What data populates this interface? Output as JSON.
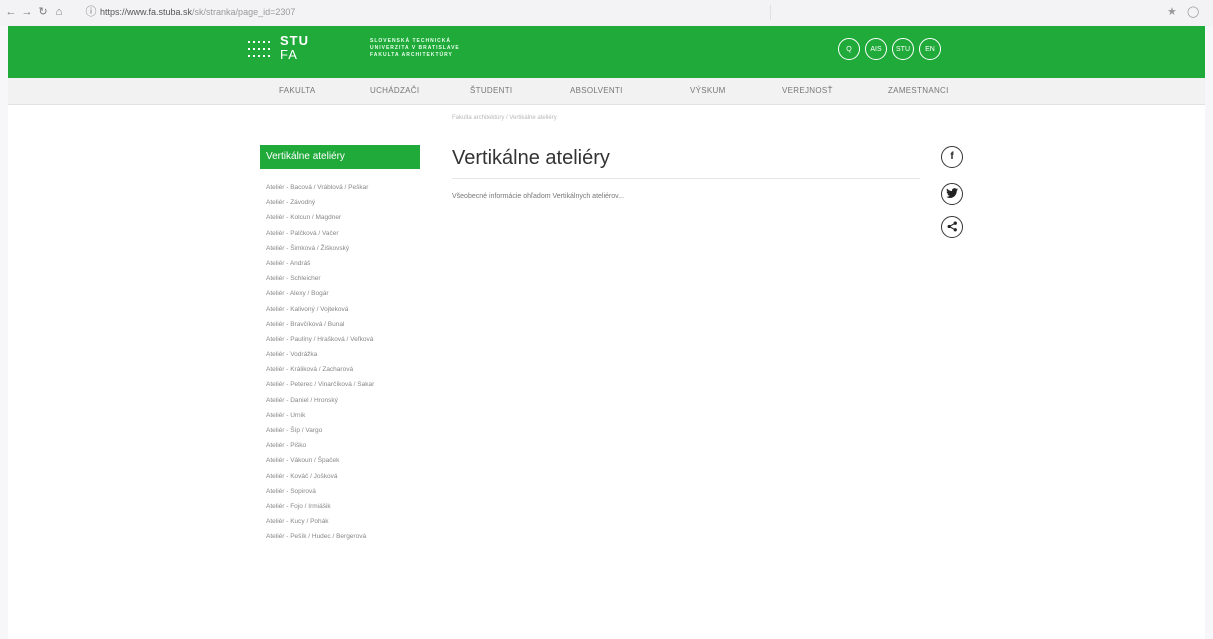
{
  "browser": {
    "url": "https://www.fa.stuba.sk/sk/stranka/page_id=2307",
    "url_host": "https://www.fa.stuba.sk",
    "url_path": "/sk/stranka/page_id=2307"
  },
  "header": {
    "logo_stu": "STU",
    "logo_fa": "FA",
    "logo_lines": [
      "SLOVENSKÁ TECHNICKÁ",
      "UNIVERZITA V BRATISLAVE",
      "FAKULTA ARCHITEKTÚRY"
    ],
    "search_label": "Q",
    "ais_label": "AIS",
    "stu_label": "STU",
    "lang_label": "EN",
    "brand_color": "#1faa3a"
  },
  "nav": {
    "items": [
      "FAKULTA",
      "UCHÁDZAČI",
      "ŠTUDENTI",
      "ABSOLVENTI",
      "VÝSKUM",
      "VEREJNOSŤ",
      "ZAMESTNANCI"
    ]
  },
  "breadcrumb": "Fakulta architektúry / Vertikálne ateliéry",
  "sidebar": {
    "title": "Vertikálne ateliéry",
    "items": [
      "Ateliér - Bacová / Vráblová / Peškar",
      "Ateliér - Závodný",
      "Ateliér - Kolcun / Magdner",
      "Ateliér - Palčková / Vačer",
      "Ateliér - Šimková / Žiškovský",
      "Ateliér - Andráš",
      "Ateliér - Schleicher",
      "Ateliér - Alexy / Bogár",
      "Ateliér - Kalivoný / Vojteková",
      "Ateliér - Bravčíková / Bunal",
      "Ateliér - Paulíny / Hrašková / Veľková",
      "Ateliér - Vodrážka",
      "Ateliér - Králiková / Zacharová",
      "Ateliér - Peterec / Vinarčíková / Sakar",
      "Ateliér - Daniel / Hronský",
      "Ateliér - Urnik",
      "Ateliér - Šíp / Vargo",
      "Ateliér - Piško",
      "Ateliér - Vákoun / Špaček",
      "Ateliér - Kováč / Jošková",
      "Ateliér - Sopirová",
      "Ateliér - Fojo / Irmiášik",
      "Ateliér - Kucy / Pohák",
      "Ateliér - Pešík / Hudec / Bergerová"
    ]
  },
  "content": {
    "title": "Vertikálne ateliéry",
    "intro": "Všeobecné informácie ohľadom Vertikálnych ateliérov..."
  },
  "share": {
    "facebook": "f",
    "twitter": "t",
    "share": "<"
  }
}
